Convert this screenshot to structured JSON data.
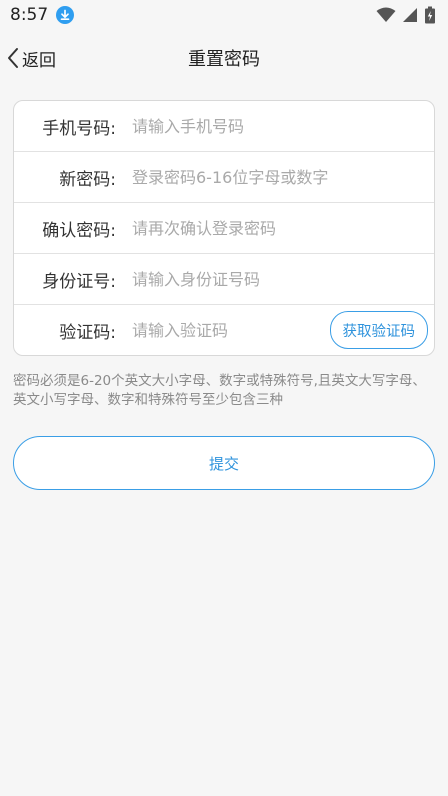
{
  "status_bar": {
    "time": "8:57"
  },
  "nav": {
    "back_label": "返回",
    "title": "重置密码"
  },
  "form": {
    "rows": [
      {
        "label": "手机号码:",
        "placeholder": "请输入手机号码"
      },
      {
        "label": "新密码:",
        "placeholder": "登录密码6-16位字母或数字"
      },
      {
        "label": "确认密码:",
        "placeholder": "请再次确认登录密码"
      },
      {
        "label": "身份证号:",
        "placeholder": "请输入身份证号码"
      },
      {
        "label": "验证码:",
        "placeholder": "请输入验证码"
      }
    ],
    "get_code_label": "获取验证码"
  },
  "hint": "密码必须是6-20个英文大小字母、数字或特殊符号,且英文大写字母、英文小写字母、数字和特殊符号至少包含三种",
  "submit_label": "提交",
  "colors": {
    "accent": "#2f93dc",
    "background": "#f6f6f6"
  }
}
